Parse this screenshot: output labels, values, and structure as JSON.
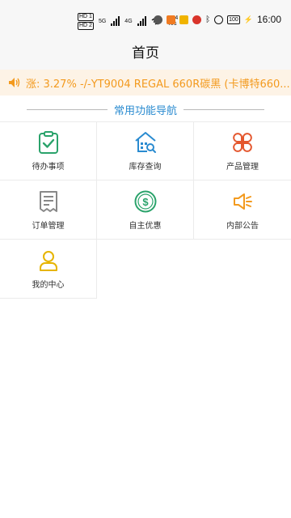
{
  "statusbar": {
    "hd1": "HD 1",
    "hd2": "HD 2",
    "net1": "5G",
    "net2": "4G",
    "speed": "13.4\nK/s",
    "battery": "100",
    "time": "16:00"
  },
  "header": {
    "title": "首页"
  },
  "marquee": {
    "text": "涨:  3.27% -/-YT9004 REGAL 660R碳黑 (卡博特660..."
  },
  "section": {
    "title": "常用功能导航"
  },
  "nav": {
    "items": [
      {
        "label": "待办事项",
        "icon": "clipboard-check-icon",
        "color": "#2aa36b"
      },
      {
        "label": "库存查询",
        "icon": "warehouse-search-icon",
        "color": "#2a8bd0"
      },
      {
        "label": "产品管理",
        "icon": "clover-icon",
        "color": "#e4572e"
      },
      {
        "label": "订单管理",
        "icon": "receipt-icon",
        "color": "#888888"
      },
      {
        "label": "自主优惠",
        "icon": "dollar-coin-icon",
        "color": "#2aa36b"
      },
      {
        "label": "内部公告",
        "icon": "megaphone-icon",
        "color": "#f39a1e"
      },
      {
        "label": "我的中心",
        "icon": "user-icon",
        "color": "#e6b400"
      }
    ]
  },
  "colors": {
    "accent": "#2a8bd0",
    "marquee_text": "#f39a1e",
    "marquee_bg": "#fdf3e6"
  }
}
